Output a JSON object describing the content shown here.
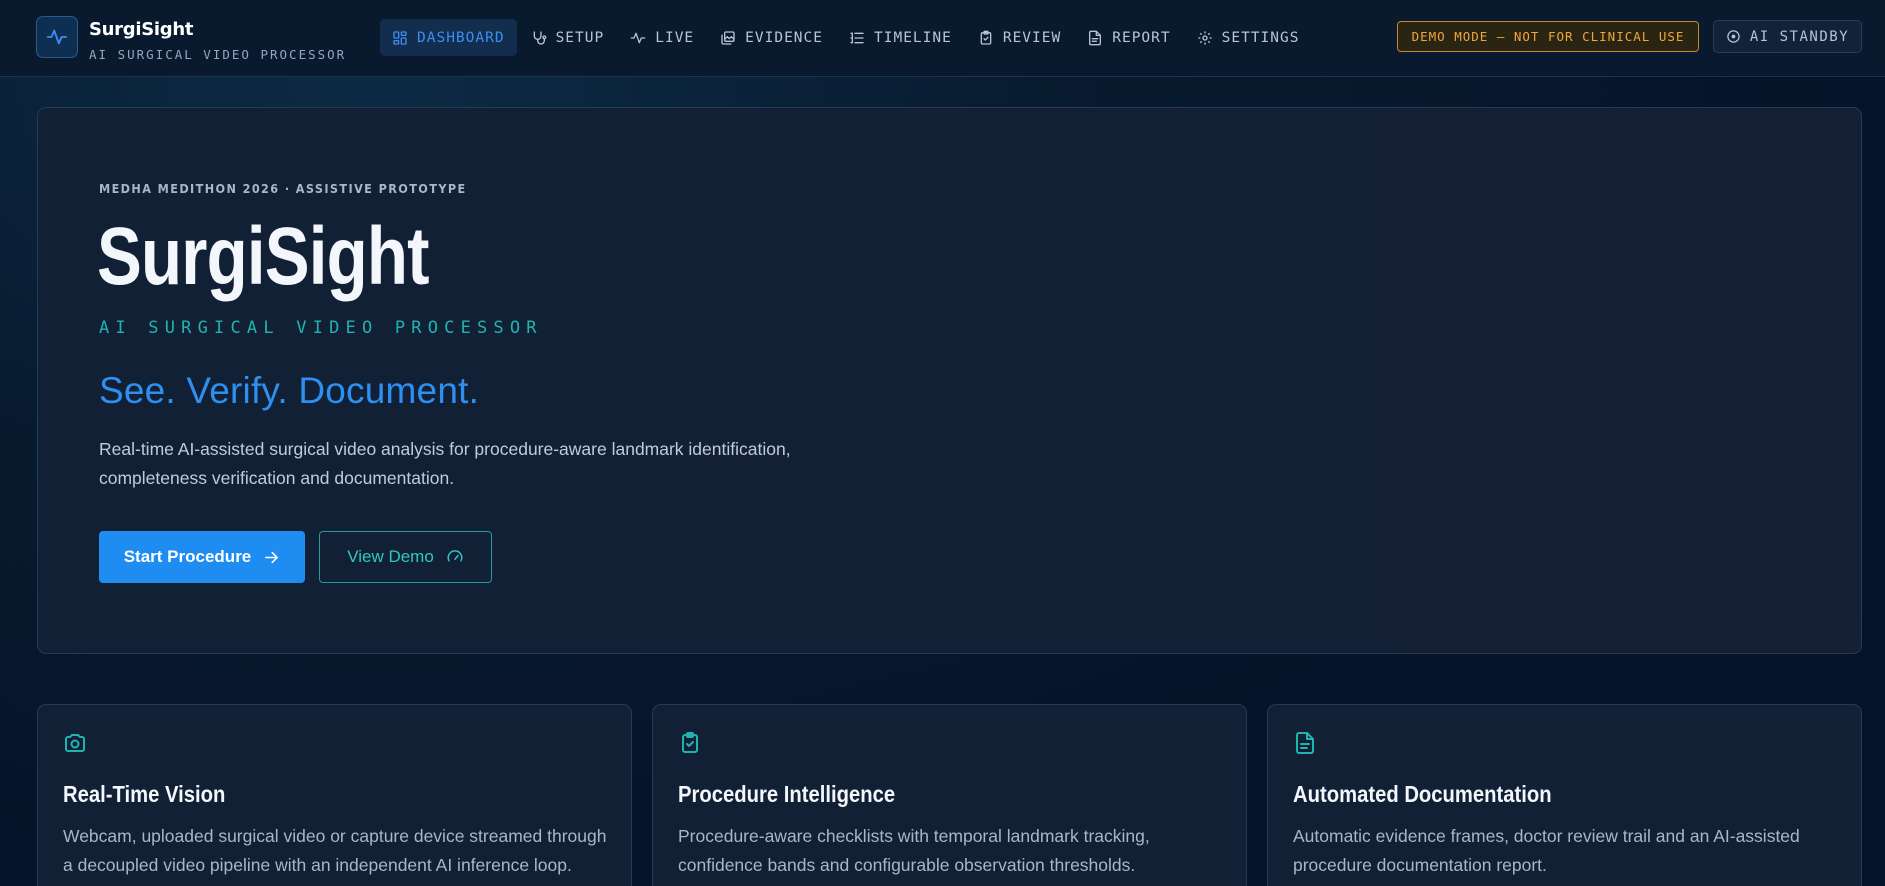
{
  "brand": {
    "name": "SurgiSight",
    "subtitle": "AI SURGICAL VIDEO PROCESSOR"
  },
  "nav": {
    "items": [
      {
        "label": "DASHBOARD",
        "icon": "grid-icon",
        "active": true
      },
      {
        "label": "SETUP",
        "icon": "stethoscope-icon",
        "active": false
      },
      {
        "label": "LIVE",
        "icon": "pulse-icon",
        "active": false
      },
      {
        "label": "EVIDENCE",
        "icon": "images-icon",
        "active": false
      },
      {
        "label": "TIMELINE",
        "icon": "list-timeline-icon",
        "active": false
      },
      {
        "label": "REVIEW",
        "icon": "clipboard-check-icon",
        "active": false
      },
      {
        "label": "REPORT",
        "icon": "file-text-icon",
        "active": false
      },
      {
        "label": "SETTINGS",
        "icon": "gear-icon",
        "active": false
      }
    ]
  },
  "status": {
    "demo_badge": "DEMO MODE — NOT FOR CLINICAL USE",
    "ai_status": "AI STANDBY"
  },
  "hero": {
    "kicker": "MEDHA MEDITHON 2026 · ASSISTIVE PROTOTYPE",
    "title": "SurgiSight",
    "subtitle": "AI SURGICAL VIDEO PROCESSOR",
    "tagline": "See. Verify. Document.",
    "description": "Real-time AI-assisted surgical video analysis for procedure-aware landmark identification, completeness verification and documentation.",
    "primary_button": "Start Procedure",
    "secondary_button": "View Demo"
  },
  "features": [
    {
      "icon": "camera-icon",
      "title": "Real-Time Vision",
      "description": "Webcam, uploaded surgical video or capture device streamed through a decoupled video pipeline with an independent AI inference loop."
    },
    {
      "icon": "clipboard-check-icon",
      "title": "Procedure Intelligence",
      "description": "Procedure-aware checklists with temporal landmark tracking, confidence bands and configurable observation thresholds."
    },
    {
      "icon": "file-text-icon",
      "title": "Automated Documentation",
      "description": "Automatic evidence frames, doctor review trail and an AI-assisted procedure documentation report."
    }
  ],
  "colors": {
    "accent": "#1e8cf0",
    "teal": "#20b3b0",
    "warning": "#f0a63a",
    "background": "#081a2e"
  }
}
